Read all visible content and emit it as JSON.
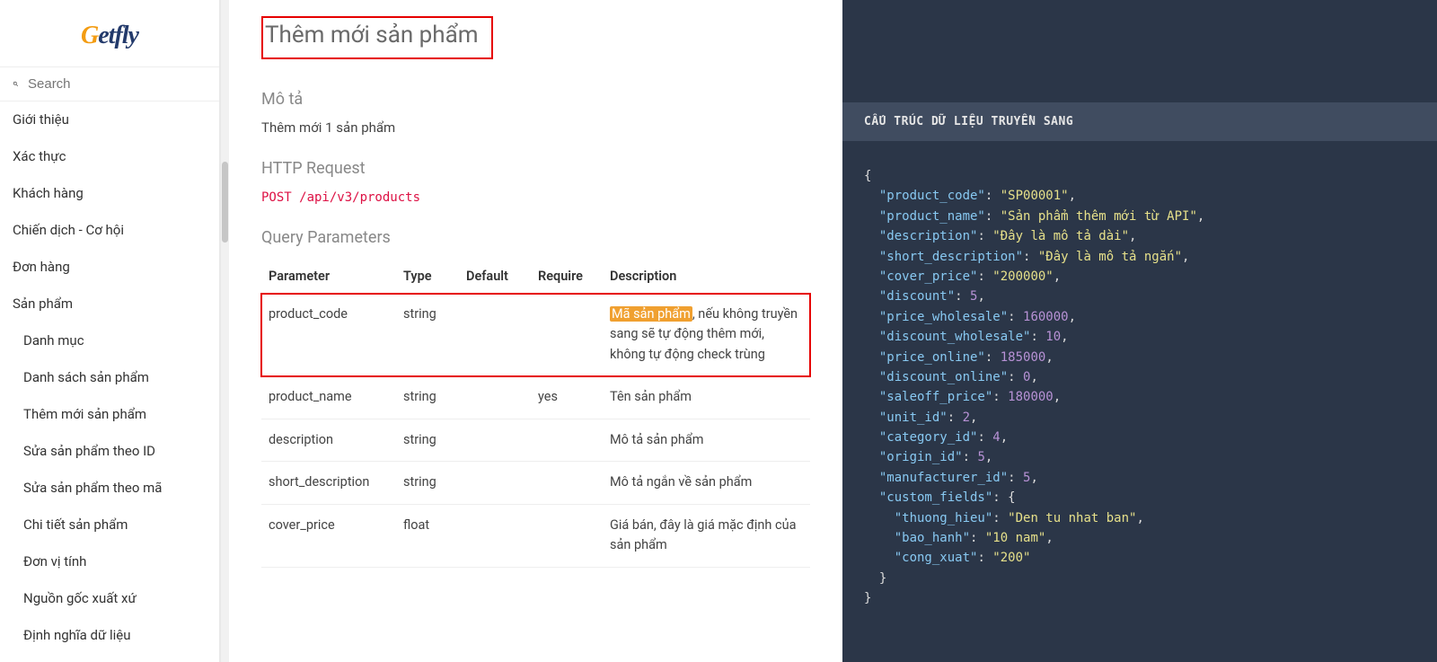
{
  "logo": {
    "prefix": "G",
    "rest": "etfly"
  },
  "search": {
    "placeholder": "Search"
  },
  "nav": [
    {
      "label": "Giới thiệu",
      "sub": false
    },
    {
      "label": "Xác thực",
      "sub": false
    },
    {
      "label": "Khách hàng",
      "sub": false
    },
    {
      "label": "Chiến dịch - Cơ hội",
      "sub": false
    },
    {
      "label": "Đơn hàng",
      "sub": false
    },
    {
      "label": "Sản phẩm",
      "sub": false
    },
    {
      "label": "Danh mục",
      "sub": true
    },
    {
      "label": "Danh sách sản phẩm",
      "sub": true
    },
    {
      "label": "Thêm mới sản phẩm",
      "sub": true
    },
    {
      "label": "Sửa sản phẩm theo ID",
      "sub": true
    },
    {
      "label": "Sửa sản phẩm theo mã",
      "sub": true
    },
    {
      "label": "Chi tiết sản phẩm",
      "sub": true
    },
    {
      "label": "Đơn vị tính",
      "sub": true
    },
    {
      "label": "Nguồn gốc xuất xứ",
      "sub": true
    },
    {
      "label": "Định nghĩa dữ liệu",
      "sub": true
    }
  ],
  "page": {
    "title": "Thêm mới sản phẩm",
    "s_desc": "Mô tả",
    "desc_text": "Thêm mới 1 sản phẩm",
    "s_http": "HTTP Request",
    "http_line": "POST /api/v3/products",
    "s_params": "Query Parameters",
    "th": {
      "p": "Parameter",
      "t": "Type",
      "d": "Default",
      "r": "Require",
      "desc": "Description"
    },
    "rows": [
      {
        "p": "product_code",
        "t": "string",
        "d": "",
        "r": "",
        "desc_hl": "Mã sản phẩm",
        "desc_rest": ", nếu không truyền sang sẽ tự động thêm mới, không tự động check trùng",
        "boxed": true
      },
      {
        "p": "product_name",
        "t": "string",
        "d": "",
        "r": "yes",
        "desc": "Tên sản phẩm"
      },
      {
        "p": "description",
        "t": "string",
        "d": "",
        "r": "",
        "desc": "Mô tả sản phẩm"
      },
      {
        "p": "short_description",
        "t": "string",
        "d": "",
        "r": "",
        "desc": "Mô tả ngắn về sản phẩm"
      },
      {
        "p": "cover_price",
        "t": "float",
        "d": "",
        "r": "",
        "desc": "Giá bán, đây là giá mặc định của sản phẩm"
      }
    ]
  },
  "code": {
    "heading": "CẤU TRÚC DỮ LIỆU TRUYỀN SANG",
    "open": "{",
    "lines": [
      {
        "k": "product_code",
        "v": "SP00001",
        "t": "s"
      },
      {
        "k": "product_name",
        "v": "Sản phẩm thêm mới từ API",
        "t": "s"
      },
      {
        "k": "description",
        "v": "Đây là mô tả dài",
        "t": "s"
      },
      {
        "k": "short_description",
        "v": "Đây là mô tả ngắn",
        "t": "s"
      },
      {
        "k": "cover_price",
        "v": "200000",
        "t": "s"
      },
      {
        "k": "discount",
        "v": "5",
        "t": "n"
      },
      {
        "k": "price_wholesale",
        "v": "160000",
        "t": "n"
      },
      {
        "k": "discount_wholesale",
        "v": "10",
        "t": "n"
      },
      {
        "k": "price_online",
        "v": "185000",
        "t": "n"
      },
      {
        "k": "discount_online",
        "v": "0",
        "t": "n"
      },
      {
        "k": "saleoff_price",
        "v": "180000",
        "t": "n"
      },
      {
        "k": "unit_id",
        "v": "2",
        "t": "n"
      },
      {
        "k": "category_id",
        "v": "4",
        "t": "n"
      },
      {
        "k": "origin_id",
        "v": "5",
        "t": "n"
      },
      {
        "k": "manufacturer_id",
        "v": "5",
        "t": "n"
      }
    ],
    "cf_key": "custom_fields",
    "cf_open": ": {",
    "cf": [
      {
        "k": "thuong_hieu",
        "v": "Den tu nhat ban"
      },
      {
        "k": "bao_hanh",
        "v": "10 nam"
      },
      {
        "k": "cong_xuat",
        "v": "200"
      }
    ],
    "cf_close": "}",
    "close": "}"
  }
}
